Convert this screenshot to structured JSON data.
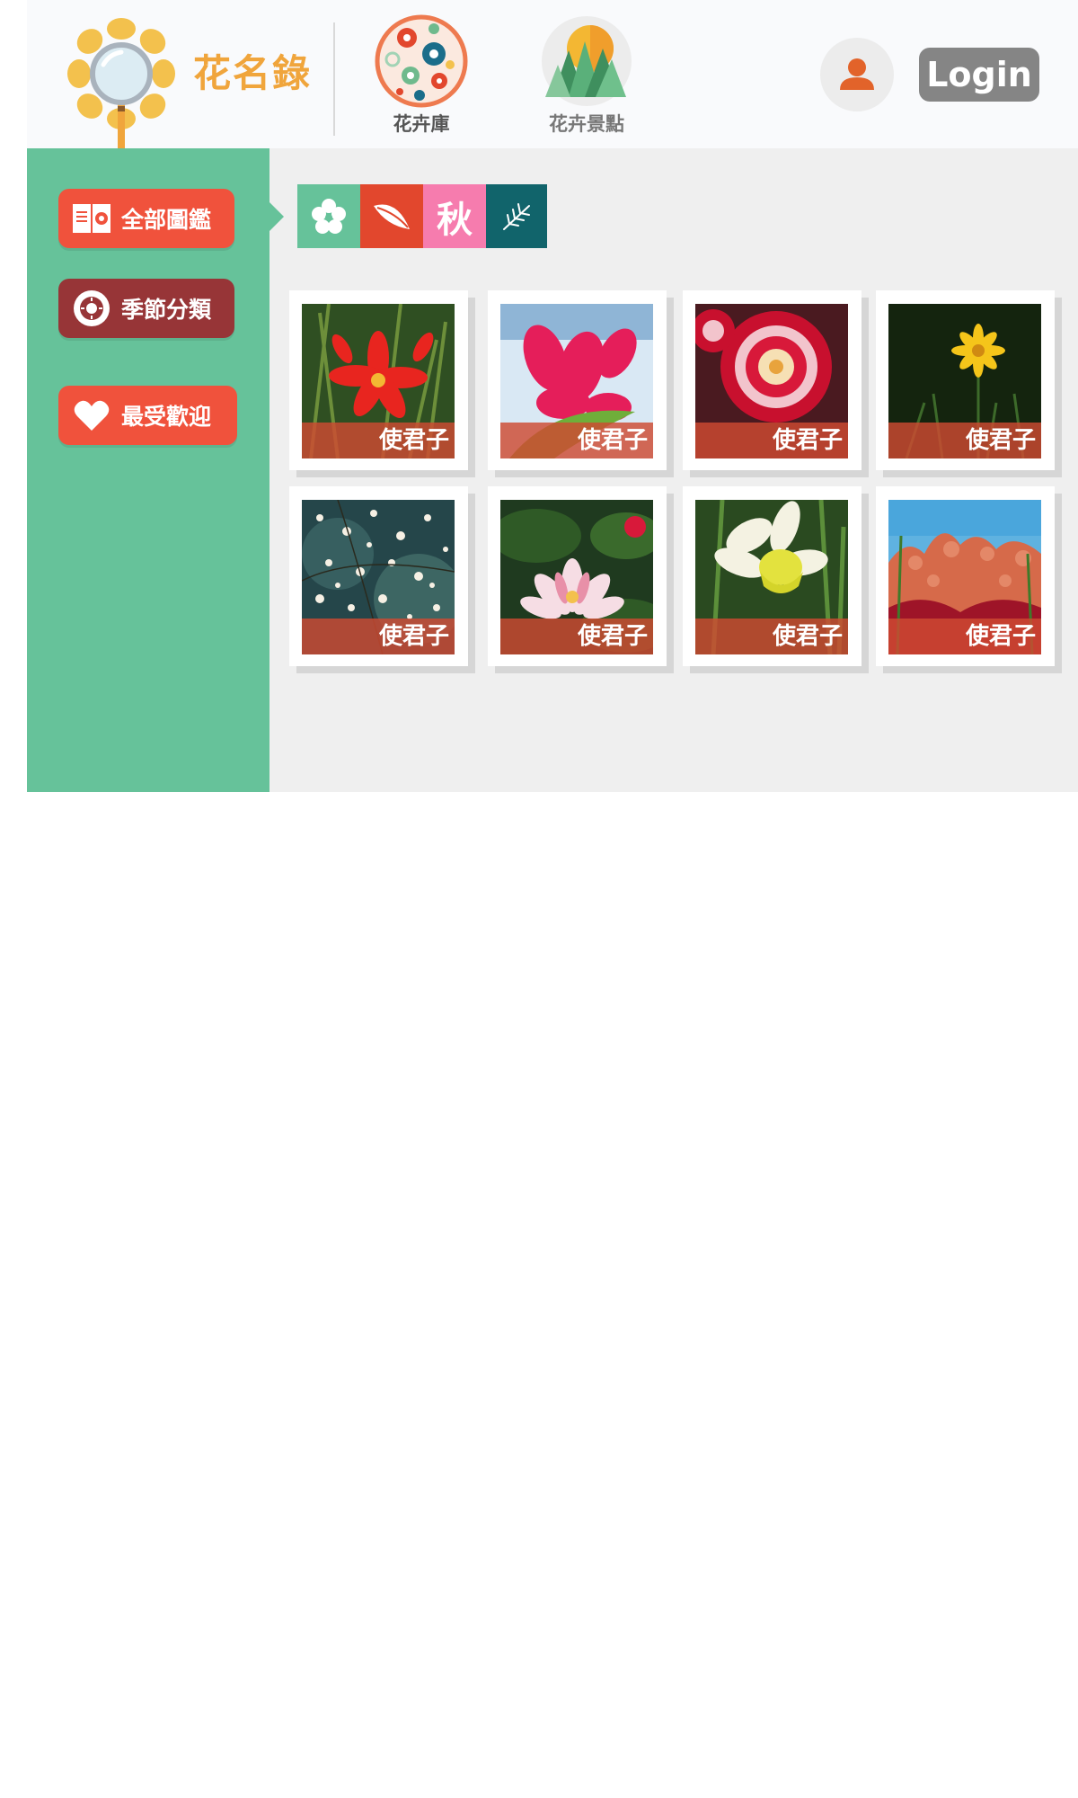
{
  "header": {
    "brand": "花名錄",
    "nav": [
      {
        "label": "花卉庫",
        "icon": "flower-pattern-icon"
      },
      {
        "label": "花卉景點",
        "icon": "mountain-sun-icon"
      }
    ],
    "user_icon": "user-icon",
    "login_label": "Login"
  },
  "sidebar": {
    "items": [
      {
        "label": "全部圖鑑",
        "icon": "book-flower-icon"
      },
      {
        "label": "季節分類",
        "icon": "season-dial-icon"
      },
      {
        "label": "最受歡迎",
        "icon": "heart-icon"
      }
    ]
  },
  "seasons": {
    "tabs": [
      {
        "icon": "blossom-icon",
        "label": ""
      },
      {
        "icon": "leaf-icon",
        "label": ""
      },
      {
        "icon": "",
        "label": "秋"
      },
      {
        "icon": "pine-branch-icon",
        "label": ""
      }
    ]
  },
  "gallery": {
    "cards": [
      {
        "caption": "使君子",
        "photo": "red lily"
      },
      {
        "caption": "使君子",
        "photo": "pink flowers"
      },
      {
        "caption": "使君子",
        "photo": "red-white rose"
      },
      {
        "caption": "使君子",
        "photo": "yellow daisy"
      },
      {
        "caption": "使君子",
        "photo": "white blossoms"
      },
      {
        "caption": "使君子",
        "photo": "water lily"
      },
      {
        "caption": "使君子",
        "photo": "daffodil"
      },
      {
        "caption": "使君子",
        "photo": "red field"
      }
    ]
  },
  "colors": {
    "header_bg": "#f9fafc",
    "brand": "#f0a53c",
    "sidebar_bg": "#66c29a",
    "accent_red": "#f0523c",
    "season_dark_red": "#973537",
    "main_bg": "#efefef",
    "caption_bg": "#ce4a32",
    "login_bg": "#858585",
    "user_accent": "#e2632a"
  }
}
